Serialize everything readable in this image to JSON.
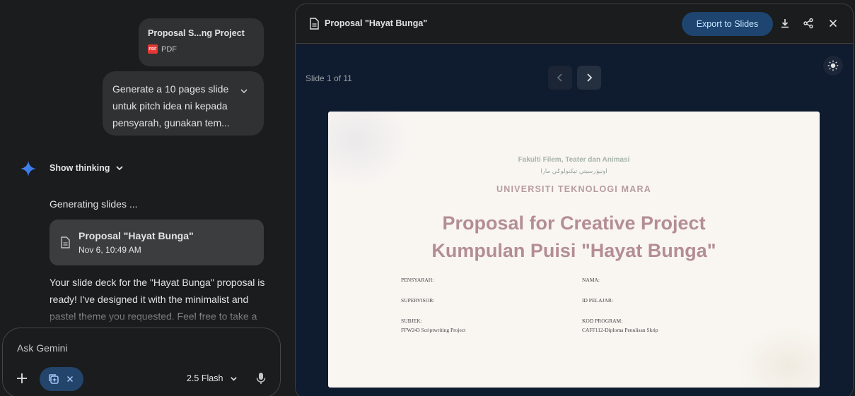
{
  "chat": {
    "attachment": {
      "name": "Proposal S...ng Project",
      "type": "PDF",
      "badge": "PDF"
    },
    "user_message": "Generate a 10 pages slide untuk pitch idea ni kepada pensyarah, gunakan tem...",
    "show_thinking_label": "Show thinking",
    "generating_text": "Generating slides ...",
    "doc_card": {
      "title": "Proposal \"Hayat Bunga\"",
      "date": "Nov 6, 10:49 AM"
    },
    "response_text": "Your slide deck for the \"Hayat Bunga\" proposal is ready! I've designed it with the minimalist and pastel theme you requested. Feel free to take a",
    "input": {
      "placeholder": "Ask Gemini",
      "model": "2.5 Flash"
    }
  },
  "preview": {
    "title": "Proposal \"Hayat Bunga\"",
    "export_label": "Export to Slides",
    "slide_counter": "Slide 1 of 11",
    "slide": {
      "faculty": "Fakulti Filem, Teater dan Animasi",
      "jawi": "اونيۏرسيتي تيكنولوݢي مارا",
      "university": "UNIVERSITI TEKNOLOGI MARA",
      "title_line1": "Proposal for Creative Project",
      "title_line2": "Kumpulan Puisi \"Hayat Bunga\"",
      "fields": {
        "pensyarah_label": "PENSYARAH:",
        "nama_label": "NAMA:",
        "supervisor_label": "SUPERVISOR:",
        "id_label": "ID PELAJAR:",
        "subjek_label": "SUBJEK:",
        "subjek_value": "FFW243 Scriptwriting Project",
        "kod_label": "KOD PROGRAM:",
        "kod_value": "CAFF112-Diploma Penulisan Skrip"
      }
    }
  },
  "colors": {
    "background": "#1b1c1d",
    "bubble": "#303132",
    "accent_button": "#1e4470",
    "preview_body": "#0f1b2e",
    "slide_title": "#b48d95"
  },
  "icons": {
    "spark": "gemini-spark-icon",
    "doc": "document-icon",
    "download": "download-icon",
    "share": "share-icon",
    "close": "close-icon",
    "theme": "brightness-icon",
    "mic": "microphone-icon",
    "plus": "plus-icon"
  }
}
